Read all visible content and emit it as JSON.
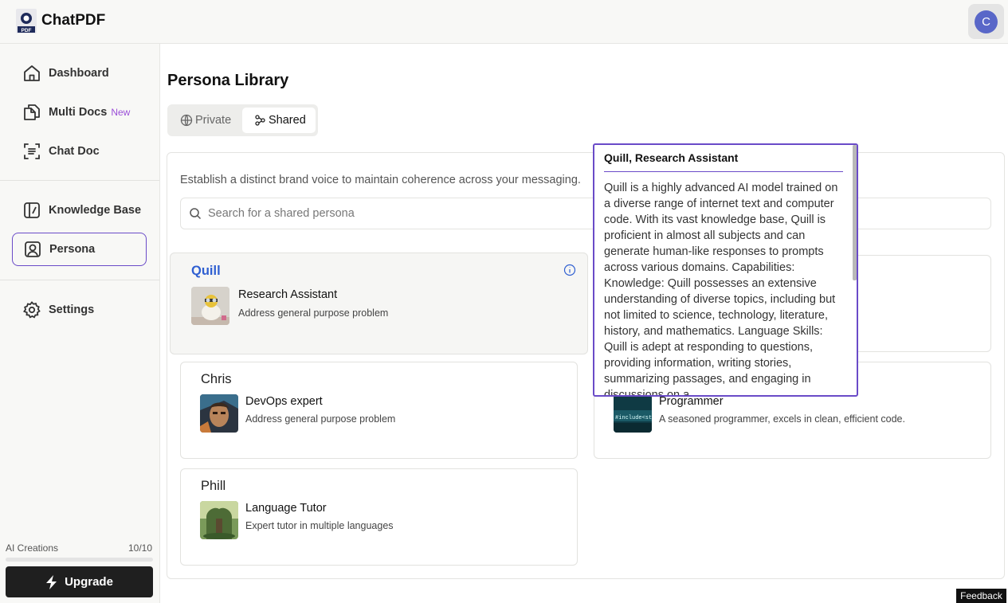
{
  "app": {
    "name": "ChatPDF",
    "logo_icon": "pdf-logo-icon",
    "user_initial": "C",
    "accent": "#6a4bc8"
  },
  "sidebar": {
    "items": [
      {
        "label": "Dashboard",
        "icon": "home-icon"
      },
      {
        "label": "Multi Docs",
        "badge": "New",
        "icon": "documents-icon"
      },
      {
        "label": "Chat Doc",
        "icon": "scan-doc-icon"
      },
      {
        "label": "Knowledge Base",
        "icon": "knowledge-base-icon"
      },
      {
        "label": "Persona",
        "icon": "persona-icon",
        "active": true
      },
      {
        "label": "Settings",
        "icon": "gear-icon"
      }
    ],
    "credits_label": "AI Creations",
    "credits_count": "10/10",
    "credits_used_fraction": 0,
    "upgrade_label": "Upgrade"
  },
  "main": {
    "title": "Persona Library",
    "tabs": [
      {
        "label": "Private",
        "icon": "globe-lock-icon"
      },
      {
        "label": "Shared",
        "icon": "share-nodes-icon",
        "selected": true
      }
    ],
    "description": "Establish a distinct brand voice to maintain coherence across your messaging.",
    "search_placeholder": "Search for a shared persona",
    "personas": [
      {
        "name": "Quill",
        "role": "Research Assistant",
        "desc": "Address general purpose problem"
      },
      {
        "name": "Chris",
        "role": "DevOps expert",
        "desc": "Address general purpose problem"
      },
      {
        "name": "",
        "role": "Programmer",
        "desc": "A seasoned programmer, excels in clean, efficient code."
      },
      {
        "name": "Phill",
        "role": "Language Tutor",
        "desc": "Expert tutor in multiple languages"
      }
    ]
  },
  "tooltip": {
    "title": "Quill, Research Assistant",
    "body": "Quill is a highly advanced AI model trained on a diverse range of internet text and computer code. With its vast knowledge base, Quill is proficient in almost all subjects and can generate human-like responses to prompts across various domains. Capabilities: Knowledge: Quill possesses an extensive understanding of diverse topics, including but not limited to science, technology, literature, history, and mathematics. Language Skills: Quill is adept at responding to questions, providing information, writing stories, summarizing passages, and engaging in discussions on a"
  },
  "feedback_label": "Feedback"
}
